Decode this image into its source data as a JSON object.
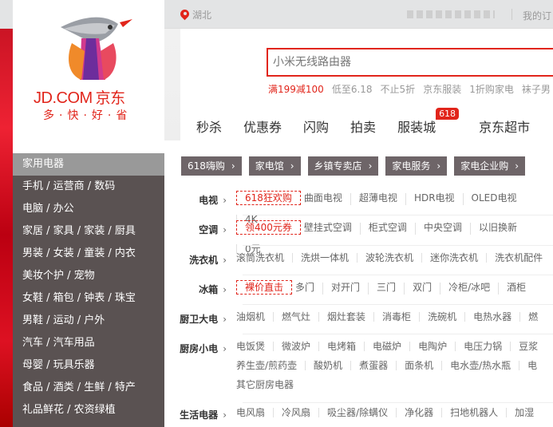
{
  "topbar": {
    "location": "湖北",
    "my_order": "我的订"
  },
  "logo": {
    "brand_en": "JD.COM",
    "brand_cn": "京东",
    "slogan": "多·快·好·省"
  },
  "search": {
    "placeholder": "小米无线路由器"
  },
  "hotwords": [
    "满199减100",
    "低至6.18",
    "不止5折",
    "京东服装",
    "1折购家电",
    "袜子男"
  ],
  "mainnav": [
    "秒杀",
    "优惠券",
    "闪购",
    "拍卖",
    "服装城",
    "京东超市"
  ],
  "mainnav_badge": "618",
  "categories": [
    "家用电器",
    "手机 / 运营商 / 数码",
    "电脑 / 办公",
    "家居 / 家具 / 家装 / 厨具",
    "男装 / 女装 / 童装 / 内衣",
    "美妆个护 / 宠物",
    "女鞋 / 箱包 / 钟表 / 珠宝",
    "男鞋 / 运动 / 户外",
    "汽车 / 汽车用品",
    "母婴 / 玩具乐器",
    "食品 / 酒类 / 生鲜 / 特产",
    "礼品鲜花 / 农资绿植"
  ],
  "tags": [
    "618嗨购",
    "家电馆",
    "乡镇专卖店",
    "家电服务",
    "家电企业购"
  ],
  "rows": [
    {
      "label": "电视",
      "promo": "618狂欢购",
      "items": [
        "曲面电视",
        "超薄电视",
        "HDR电视",
        "OLED电视",
        "4K"
      ]
    },
    {
      "label": "空调",
      "promo": "领400元券",
      "items": [
        "壁挂式空调",
        "柜式空调",
        "中央空调",
        "以旧换新",
        "0元"
      ]
    },
    {
      "label": "洗衣机",
      "promo": "",
      "items": [
        "滚筒洗衣机",
        "洗烘一体机",
        "波轮洗衣机",
        "迷你洗衣机",
        "洗衣机配件"
      ]
    },
    {
      "label": "冰箱",
      "promo": "裸价直击",
      "items": [
        "多门",
        "对开门",
        "三门",
        "双门",
        "冷柜/冰吧",
        "酒柜"
      ]
    },
    {
      "label": "厨卫大电",
      "promo": "",
      "items": [
        "油烟机",
        "燃气灶",
        "烟灶套装",
        "消毒柜",
        "洗碗机",
        "电热水器",
        "燃"
      ]
    },
    {
      "label": "厨房小电",
      "promo": "",
      "items": [
        "电饭煲",
        "微波炉",
        "电烤箱",
        "电磁炉",
        "电陶炉",
        "电压力锅",
        "豆浆",
        "养生壶/煎药壶",
        "酸奶机",
        "煮蛋器",
        "面条机",
        "电水壶/热水瓶",
        "电",
        "其它厨房电器"
      ]
    },
    {
      "label": "生活电器",
      "promo": "",
      "items": [
        "电风扇",
        "冷风扇",
        "吸尘器/除螨仪",
        "净化器",
        "扫地机器人",
        "加湿"
      ]
    }
  ]
}
